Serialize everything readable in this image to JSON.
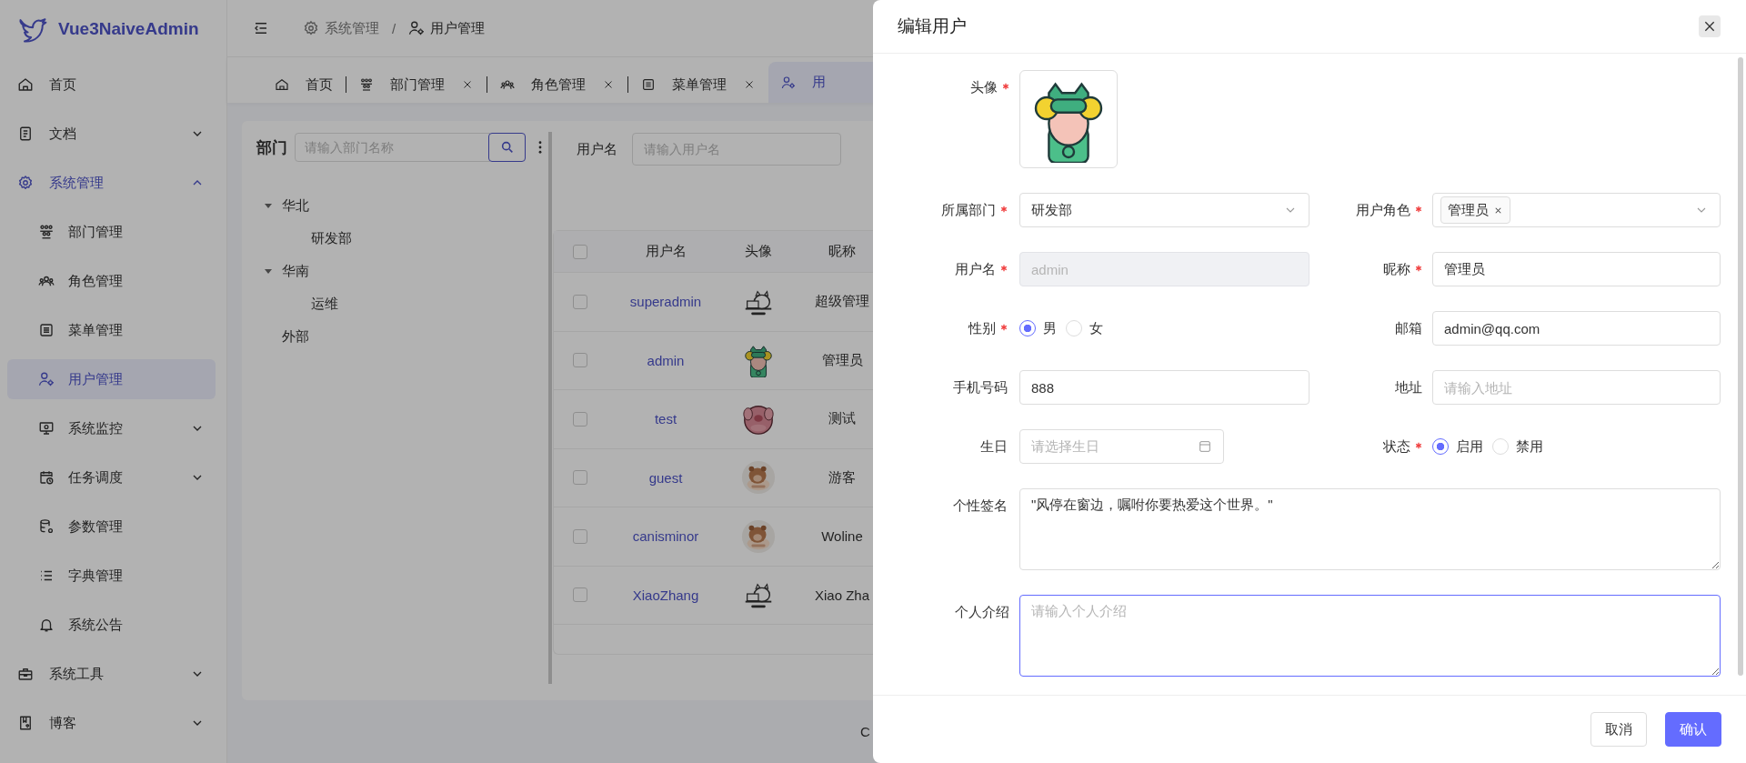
{
  "sidebar": {
    "logo": "Vue3NaiveAdmin",
    "items": [
      {
        "label": "首页",
        "selected": false
      },
      {
        "label": "文档",
        "selected": false,
        "expanded": false
      },
      {
        "label": "系统管理",
        "selected": false,
        "expanded": true,
        "children": [
          {
            "label": "部门管理",
            "selected": false
          },
          {
            "label": "角色管理",
            "selected": false
          },
          {
            "label": "菜单管理",
            "selected": false
          },
          {
            "label": "用户管理",
            "selected": true
          },
          {
            "label": "系统监控",
            "selected": false,
            "expanded": false
          },
          {
            "label": "任务调度",
            "selected": false,
            "expanded": false
          },
          {
            "label": "参数管理",
            "selected": false
          },
          {
            "label": "字典管理",
            "selected": false
          },
          {
            "label": "系统公告",
            "selected": false
          }
        ]
      },
      {
        "label": "系统工具",
        "selected": false,
        "expanded": false
      },
      {
        "label": "博客",
        "selected": false,
        "expanded": false
      }
    ]
  },
  "header": {
    "breadcrumb": [
      {
        "label": "系统管理"
      },
      {
        "label": "用户管理"
      }
    ],
    "separator": "/"
  },
  "tabs": [
    {
      "label": "首页",
      "closable": false,
      "selected": false
    },
    {
      "label": "部门管理",
      "closable": true,
      "selected": false
    },
    {
      "label": "角色管理",
      "closable": true,
      "selected": false
    },
    {
      "label": "菜单管理",
      "closable": true,
      "selected": false
    },
    {
      "label": "用",
      "closable": false,
      "selected": true
    }
  ],
  "dept_panel": {
    "title": "部门",
    "search": {
      "placeholder": "请输入部门名称"
    },
    "tree": [
      {
        "label": "华北",
        "expanded": true,
        "children": [
          {
            "label": "研发部"
          }
        ]
      },
      {
        "label": "华南",
        "expanded": true,
        "children": [
          {
            "label": "运维"
          }
        ]
      },
      {
        "label": "外部"
      }
    ]
  },
  "query": {
    "label": "用户名",
    "placeholder": "请输入用户名"
  },
  "table": {
    "select_all": {
      "checked": false
    },
    "columns": [
      "用户名",
      "头像",
      "昵称"
    ],
    "rows": [
      {
        "checked": false,
        "username": "superadmin",
        "nickname": "超级管理"
      },
      {
        "checked": false,
        "username": "admin",
        "nickname": "管理员"
      },
      {
        "checked": false,
        "username": "test",
        "nickname": "测试"
      },
      {
        "checked": false,
        "username": "guest",
        "nickname": "游客"
      },
      {
        "checked": false,
        "username": "canisminor",
        "nickname": "Woline"
      },
      {
        "checked": false,
        "username": "XiaoZhang",
        "nickname": "Xiao Zha"
      }
    ]
  },
  "footer": {
    "text": "C"
  },
  "drawer": {
    "title": "编辑用户",
    "fields": [
      {
        "label": "头像",
        "required": true,
        "kind": "avatar"
      },
      {
        "label": "所属部门",
        "required": true,
        "kind": "select",
        "value": "研发部"
      },
      {
        "label": "用户角色",
        "required": true,
        "kind": "tags",
        "tags": [
          "管理员"
        ]
      },
      {
        "label": "用户名",
        "required": true,
        "kind": "input",
        "value": "admin",
        "disabled": true
      },
      {
        "label": "昵称",
        "required": true,
        "kind": "input",
        "value": "管理员",
        "disabled": false
      },
      {
        "label": "性别",
        "required": true,
        "kind": "radio",
        "options": [
          {
            "label": "男",
            "selected": true
          },
          {
            "label": "女",
            "selected": false
          }
        ]
      },
      {
        "label": "邮箱",
        "required": false,
        "kind": "input",
        "value": "admin@qq.com",
        "disabled": false
      },
      {
        "label": "手机号码",
        "required": false,
        "kind": "input",
        "value": "888",
        "disabled": false
      },
      {
        "label": "地址",
        "required": false,
        "kind": "input",
        "placeholder": "请输入地址",
        "disabled": false
      },
      {
        "label": "生日",
        "required": false,
        "kind": "date",
        "placeholder": "请选择生日"
      },
      {
        "label": "状态",
        "required": true,
        "kind": "radio",
        "options": [
          {
            "label": "启用",
            "selected": true
          },
          {
            "label": "禁用",
            "selected": false
          }
        ]
      },
      {
        "label": "个性签名",
        "required": false,
        "kind": "textarea",
        "value": "\"风停在窗边，嘱咐你要热爱这个世界。\"",
        "focused": false
      },
      {
        "label": "个人介绍",
        "required": false,
        "kind": "textarea",
        "placeholder": "请输入个人介绍",
        "focused": true
      }
    ],
    "buttons": [
      {
        "label": "取消",
        "kind": "default"
      },
      {
        "label": "确认",
        "kind": "primary"
      }
    ]
  }
}
